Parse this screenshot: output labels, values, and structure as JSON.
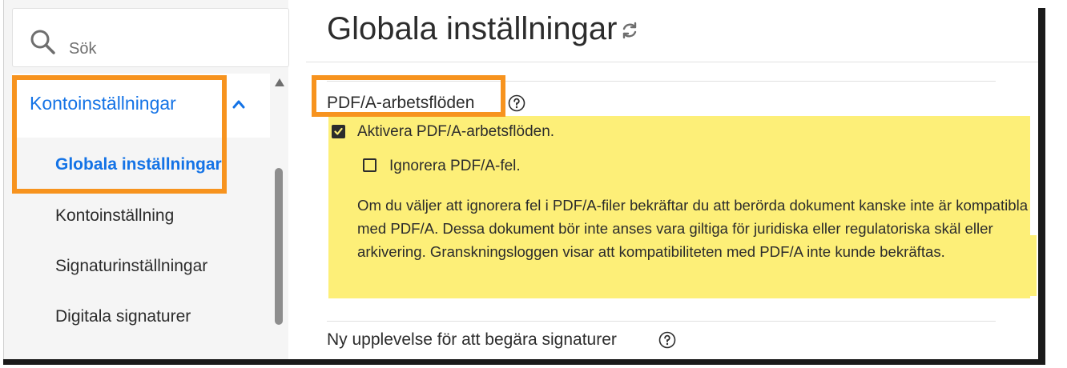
{
  "sidebar": {
    "search": {
      "placeholder": "Sök",
      "icon": "search-icon"
    },
    "group": {
      "label": "Kontoinställningar",
      "expanded": true,
      "items": [
        {
          "label": "Globala inställningar",
          "active": true
        },
        {
          "label": "Kontoinställning",
          "active": false
        },
        {
          "label": "Signaturinställningar",
          "active": false
        },
        {
          "label": "Digitala signaturer",
          "active": false
        }
      ]
    }
  },
  "main": {
    "title": "Globala inställningar",
    "sections": [
      {
        "label": "PDF/A-arbetsflöden",
        "options": [
          {
            "label": "Aktivera PDF/A-arbetsflöden.",
            "checked": true
          },
          {
            "label": "Ignorera PDF/A-fel.",
            "checked": false
          }
        ],
        "description": "Om du väljer att ignorera fel i PDF/A-filer bekräftar du att berörda dokument kanske inte är kompatibla med PDF/A. Dessa dokument bör inte anses vara giltiga för juridiska eller regulatoriska skäl eller arkivering. Granskningsloggen visar att kompatibiliteten med PDF/A inte kunde bekräftas."
      },
      {
        "label": "Ny upplevelse för att begära signaturer"
      }
    ]
  },
  "colors": {
    "accent": "#1473e6",
    "highlight": "#fdef78",
    "annotation": "#f7931e",
    "text": "#2c2c2c"
  }
}
